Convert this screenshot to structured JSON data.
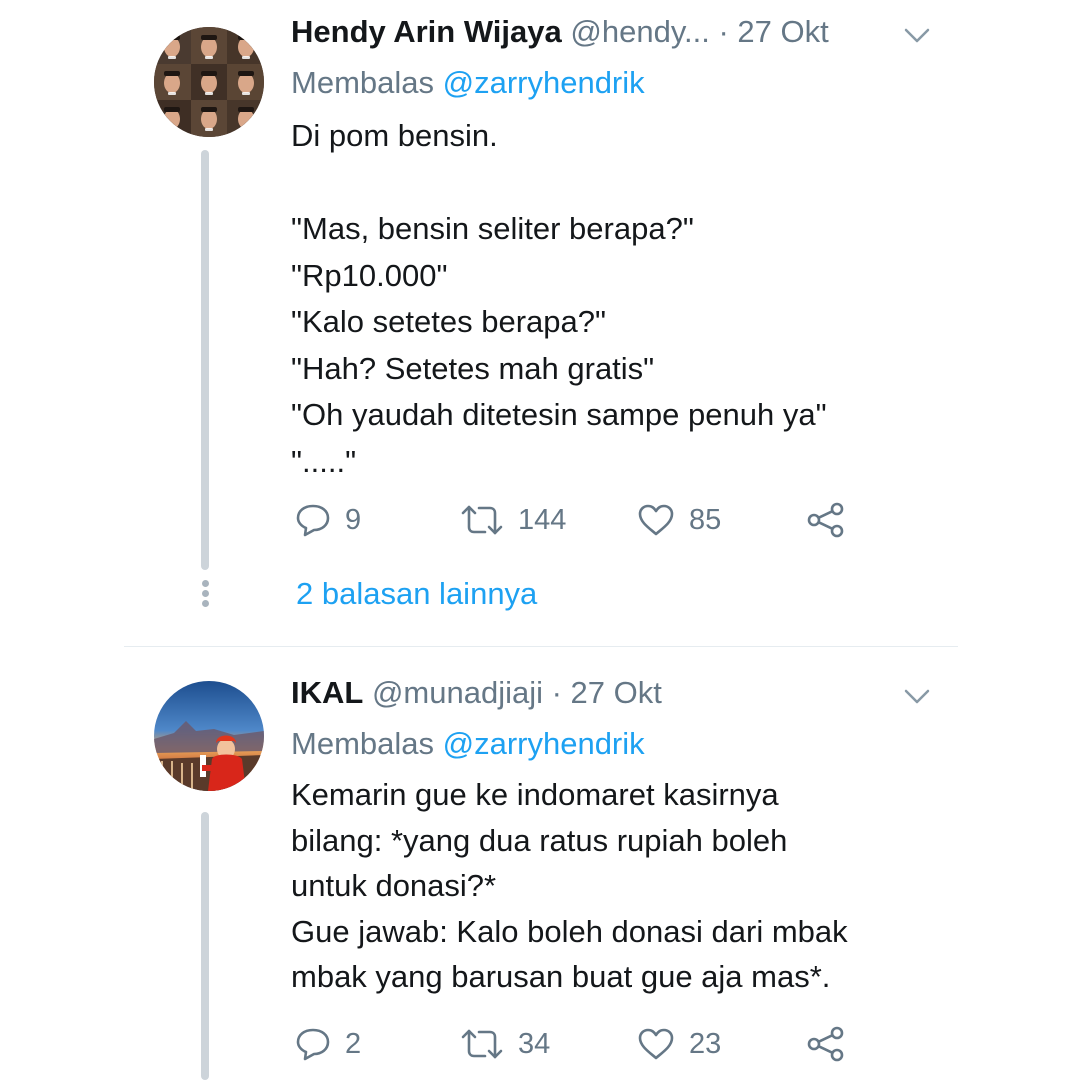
{
  "tweets": [
    {
      "name": "Hendy Arin Wijaya",
      "handle": "@hendy...",
      "date": "· 27 Okt",
      "reply_prefix": "Membalas ",
      "reply_mention": "@zarryhendrik",
      "text": "Di pom bensin.\n\n\"Mas, bensin seliter berapa?\"\n\"Rp10.000\"\n\"Kalo setetes berapa?\"\n\"Hah? Setetes mah gratis\"\n\"Oh yaudah ditetesin sampe penuh ya\"\n\".....\"",
      "replies": "9",
      "retweets": "144",
      "likes": "85",
      "more_replies": "2 balasan lainnya",
      "icons": {
        "reply": "reply-icon",
        "retweet": "retweet-icon",
        "like": "heart-icon",
        "share": "share-icon",
        "menu": "chevron-down-icon"
      }
    },
    {
      "name": "IKAL",
      "handle": "@munadjiaji",
      "date": "· 27 Okt",
      "reply_prefix": "Membalas ",
      "reply_mention": "@zarryhendrik",
      "text": "Kemarin gue ke indomaret kasirnya\nbilang: *yang dua ratus rupiah boleh\nuntuk donasi?*\nGue jawab: Kalo boleh donasi dari mbak\nmbak yang barusan buat gue aja mas*.",
      "replies": "2",
      "retweets": "34",
      "likes": "23",
      "icons": {
        "reply": "reply-icon",
        "retweet": "retweet-icon",
        "like": "heart-icon",
        "share": "share-icon",
        "menu": "chevron-down-icon"
      }
    }
  ],
  "colors": {
    "text": "#14171a",
    "secondary": "#657786",
    "link": "#1da1f2",
    "thread_line": "#cdd4da",
    "divider": "#e6ecf0"
  }
}
